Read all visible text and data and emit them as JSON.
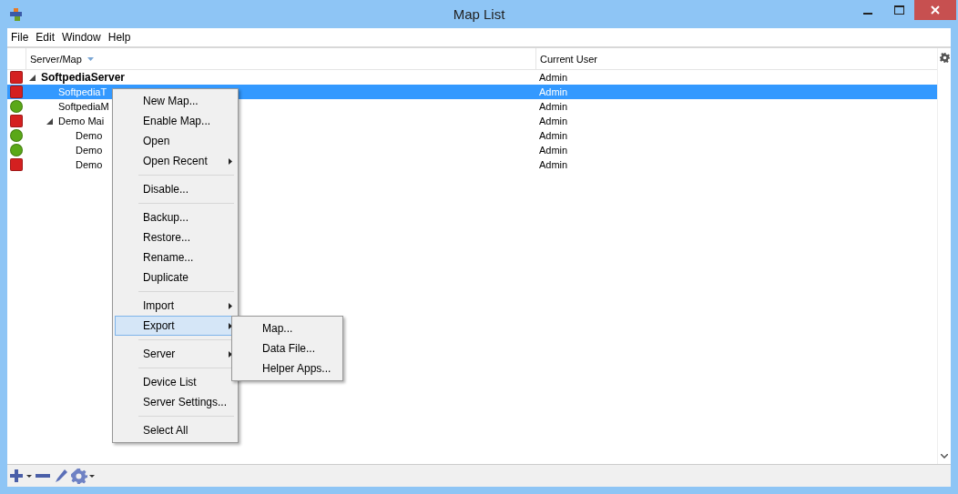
{
  "window": {
    "title": "Map List"
  },
  "menu_bar": [
    "File",
    "Edit",
    "Window",
    "Help"
  ],
  "table": {
    "columns": [
      {
        "label": "Server/Map",
        "sorted": true
      },
      {
        "label": "Current User",
        "sorted": false
      }
    ],
    "rows": [
      {
        "name": "SoftpediaServer",
        "bold": true,
        "color": "#d42020",
        "user": "Admin",
        "selected": false,
        "expanded": true,
        "children": [
          {
            "name": "SoftpediaT",
            "bold": false,
            "color": "#d42020",
            "user": "Admin",
            "selected": true
          },
          {
            "name": "SoftpediaM",
            "bold": false,
            "color": "#5aa818",
            "user": "Admin",
            "selected": false
          },
          {
            "name": "Demo Mai",
            "bold": false,
            "color": "#d42020",
            "user": "Admin",
            "selected": false,
            "expanded": true,
            "children": [
              {
                "name": "Demo",
                "bold": false,
                "color": "#5aa818",
                "user": "Admin",
                "selected": false
              },
              {
                "name": "Demo",
                "bold": false,
                "color": "#5aa818",
                "user": "Admin",
                "selected": false
              },
              {
                "name": "Demo",
                "bold": false,
                "color": "#d42020",
                "user": "Admin",
                "selected": false
              }
            ]
          }
        ]
      }
    ]
  },
  "context_menu": {
    "groups": [
      [
        {
          "label": "New Map...",
          "submenu": false,
          "selected": false
        },
        {
          "label": "Enable Map...",
          "submenu": false,
          "selected": false
        },
        {
          "label": "Open",
          "submenu": false,
          "selected": false
        },
        {
          "label": "Open Recent",
          "submenu": true,
          "selected": false
        }
      ],
      [
        {
          "label": "Disable...",
          "submenu": false,
          "selected": false
        }
      ],
      [
        {
          "label": "Backup...",
          "submenu": false,
          "selected": false
        },
        {
          "label": "Restore...",
          "submenu": false,
          "selected": false
        },
        {
          "label": "Rename...",
          "submenu": false,
          "selected": false
        },
        {
          "label": "Duplicate",
          "submenu": false,
          "selected": false
        }
      ],
      [
        {
          "label": "Import",
          "submenu": true,
          "selected": false
        },
        {
          "label": "Export",
          "submenu": true,
          "selected": true
        }
      ],
      [
        {
          "label": "Server",
          "submenu": true,
          "selected": false
        }
      ],
      [
        {
          "label": "Device List",
          "submenu": false,
          "selected": false
        },
        {
          "label": "Server Settings...",
          "submenu": false,
          "selected": false
        }
      ],
      [
        {
          "label": "Select All",
          "submenu": false,
          "selected": false
        }
      ]
    ]
  },
  "submenu": {
    "items": [
      "Map...",
      "Data File...",
      "Helper Apps..."
    ]
  }
}
